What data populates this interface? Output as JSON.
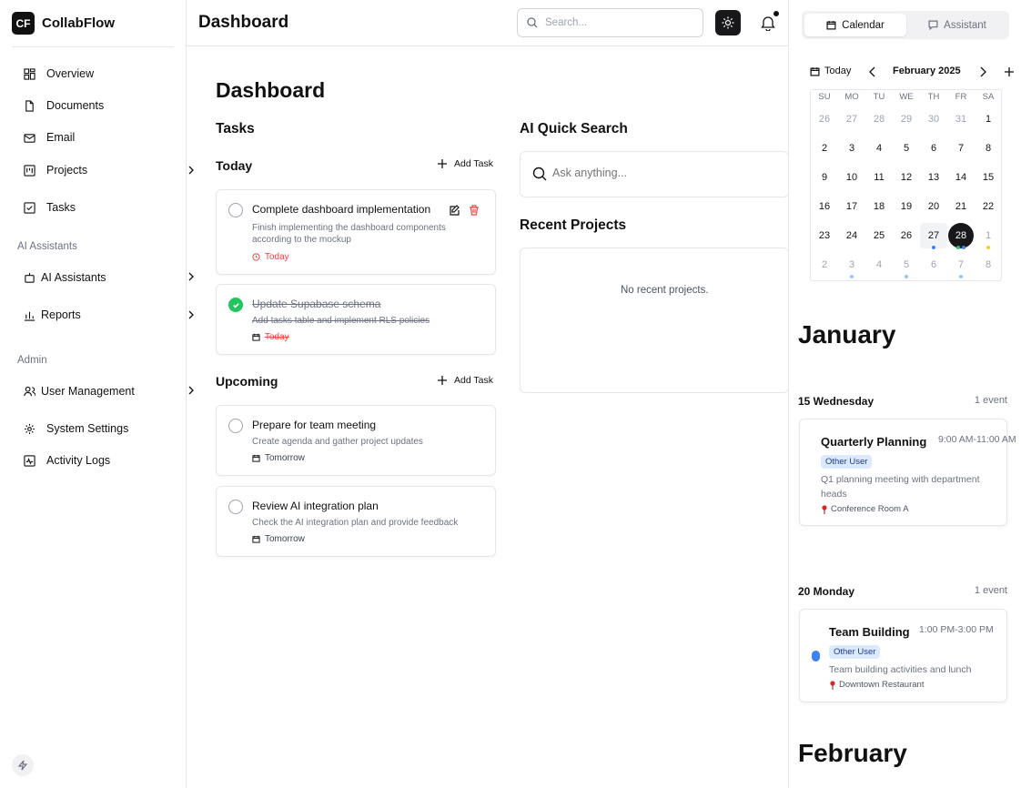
{
  "app": {
    "name": "CollabFlow",
    "logo_text": "CF"
  },
  "sidebar": {
    "items": [
      {
        "label": "Overview",
        "icon": "grid-icon"
      },
      {
        "label": "Documents",
        "icon": "file-icon"
      },
      {
        "label": "Email",
        "icon": "mail-icon"
      },
      {
        "label": "Projects",
        "icon": "kanban-icon"
      },
      {
        "label": "Tasks",
        "icon": "check-square-icon"
      }
    ],
    "ai_section": "AI Assistants",
    "ai_items": [
      {
        "label": "AI Assistants",
        "icon": "bot-icon"
      },
      {
        "label": "Reports",
        "icon": "bar-chart-icon"
      }
    ],
    "admin_section": "Admin",
    "admin_items": [
      {
        "label": "User Management",
        "icon": "users-icon"
      },
      {
        "label": "System Settings",
        "icon": "gear-icon"
      },
      {
        "label": "Activity Logs",
        "icon": "activity-icon"
      }
    ]
  },
  "header": {
    "title": "Dashboard",
    "search_placeholder": "Search..."
  },
  "main": {
    "title": "Dashboard",
    "tasks_title": "Tasks",
    "today_label": "Today",
    "upcoming_label": "Upcoming",
    "add_task_label": "Add Task",
    "today_tasks": [
      {
        "title": "Complete dashboard implementation",
        "desc": "Finish implementing the dashboard components according to the mockup",
        "due": "Today",
        "done": false
      },
      {
        "title": "Update Supabase schema",
        "desc": "Add tasks table and implement RLS policies",
        "due": "Today",
        "done": true
      }
    ],
    "upcoming_tasks": [
      {
        "title": "Prepare for team meeting",
        "desc": "Create agenda and gather project updates",
        "due": "Tomorrow",
        "done": false
      },
      {
        "title": "Review AI integration plan",
        "desc": "Check the AI integration plan and provide feedback",
        "due": "Tomorrow",
        "done": false
      }
    ],
    "ai_search_title": "AI Quick Search",
    "ai_search_placeholder": "Ask anything...",
    "recent_projects_title": "Recent Projects",
    "recent_projects_empty": "No recent projects."
  },
  "right_panel": {
    "tabs": [
      {
        "label": "Calendar",
        "icon": "calendar-icon"
      },
      {
        "label": "Assistant",
        "icon": "message-icon"
      }
    ],
    "today_button": "Today",
    "month_label": "February 2025",
    "weekdays": [
      "SU",
      "MO",
      "TU",
      "WE",
      "TH",
      "FR",
      "SA"
    ],
    "weeks": [
      [
        "26",
        "27",
        "28",
        "29",
        "30",
        "31",
        "1"
      ],
      [
        "2",
        "3",
        "4",
        "5",
        "6",
        "7",
        "8"
      ],
      [
        "9",
        "10",
        "11",
        "12",
        "13",
        "14",
        "15"
      ],
      [
        "16",
        "17",
        "18",
        "19",
        "20",
        "21",
        "22"
      ],
      [
        "23",
        "24",
        "25",
        "26",
        "27",
        "28",
        "1"
      ],
      [
        "2",
        "3",
        "4",
        "5",
        "6",
        "7",
        "8"
      ]
    ],
    "event_colors": {
      "blue": "#3b82f6",
      "green": "#22c55e",
      "yellow": "#facc15",
      "light_blue": "#93c5fd"
    },
    "months": [
      {
        "name": "January",
        "days": [
          {
            "label": "15 Wednesday",
            "count": "1 event",
            "event": {
              "title": "Quarterly Planning",
              "time": "9:00 AM-11:00 AM",
              "badge": "Other User",
              "desc": "Q1 planning meeting with department heads",
              "location": "Conference Room A"
            }
          },
          {
            "label": "20 Monday",
            "count": "1 event",
            "event": {
              "title": "Team Building",
              "time": "1:00 PM-3:00 PM",
              "badge": "Other User",
              "desc": "Team building activities and lunch",
              "location": "Downtown Restaurant"
            }
          }
        ]
      },
      {
        "name": "February"
      }
    ]
  }
}
